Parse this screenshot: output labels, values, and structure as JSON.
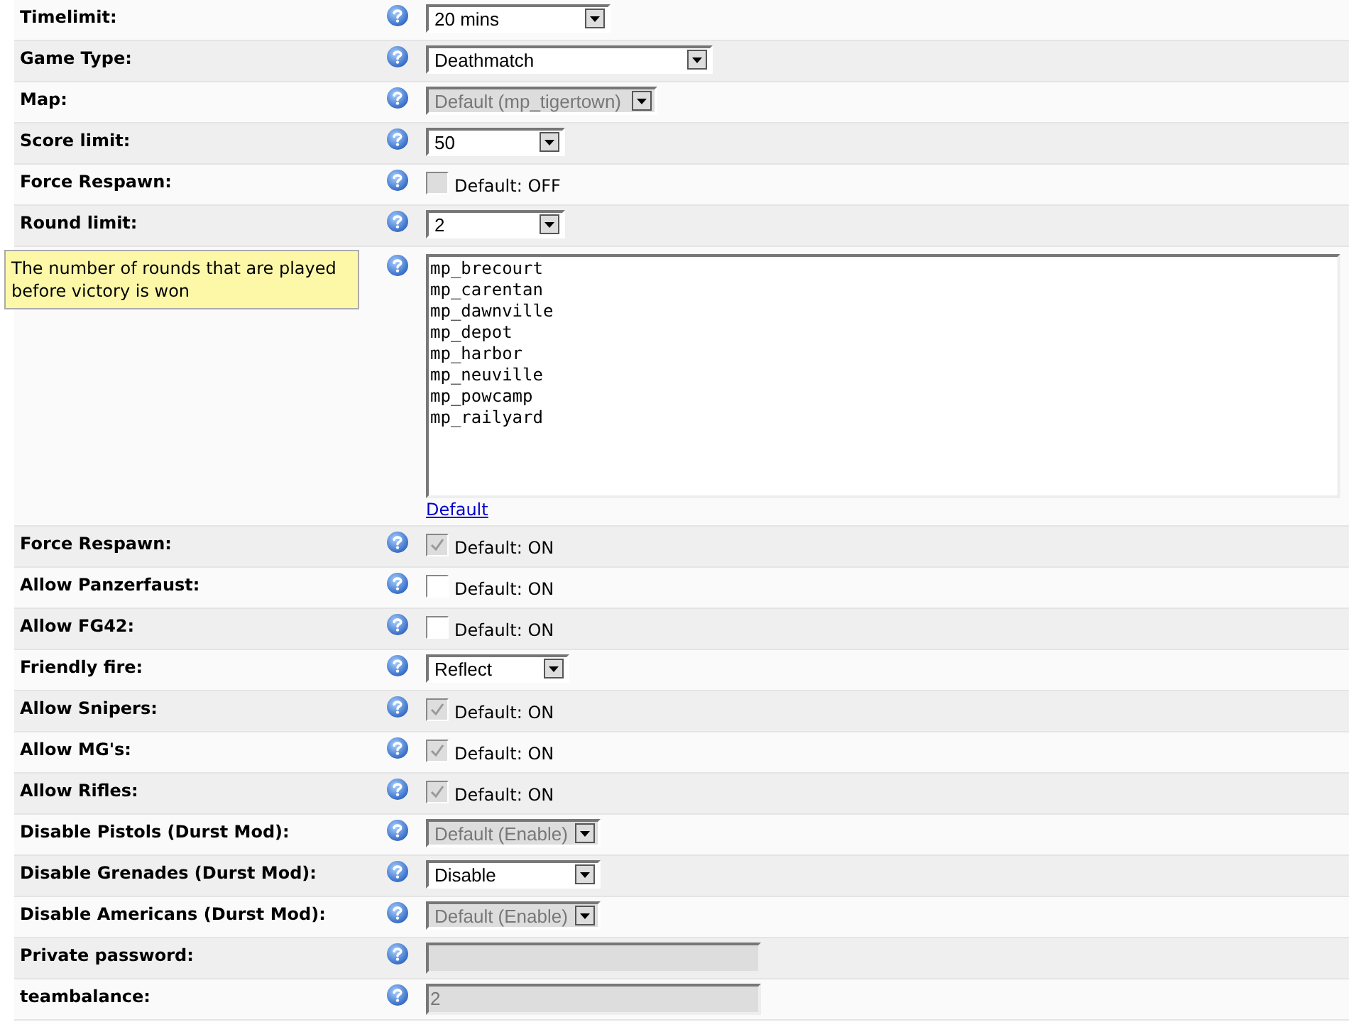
{
  "settings": [
    {
      "kind": "select",
      "label": "Timelimit:",
      "value": "20 mins",
      "disabled": false
    },
    {
      "kind": "select",
      "label": "Game Type:",
      "value": "Deathmatch",
      "disabled": false
    },
    {
      "kind": "select",
      "label": "Map:",
      "value": "Default (mp_tigertown)",
      "disabled": true
    },
    {
      "kind": "select",
      "label": "Score limit:",
      "value": "50",
      "disabled": false
    },
    {
      "kind": "checkbox",
      "label": "Force Respawn:",
      "text": "Default: OFF",
      "checked": false,
      "disabled": true
    },
    {
      "kind": "select",
      "label": "Round limit:",
      "value": "2",
      "disabled": false
    },
    {
      "kind": "maplist",
      "items": [
        "mp_brecourt",
        "mp_carentan",
        "mp_dawnville",
        "mp_depot",
        "mp_harbor",
        "mp_neuville",
        "mp_powcamp",
        "mp_railyard"
      ],
      "link": "Default"
    },
    {
      "kind": "checkbox",
      "label": "Force Respawn:",
      "text": "Default: ON",
      "checked": true,
      "disabled": true
    },
    {
      "kind": "checkbox",
      "label": "Allow Panzerfaust:",
      "text": "Default: ON",
      "checked": false,
      "disabled": false
    },
    {
      "kind": "checkbox",
      "label": "Allow FG42:",
      "text": "Default: ON",
      "checked": false,
      "disabled": false
    },
    {
      "kind": "select",
      "label": "Friendly fire:",
      "value": "Reflect",
      "disabled": false
    },
    {
      "kind": "checkbox",
      "label": "Allow Snipers:",
      "text": "Default: ON",
      "checked": true,
      "disabled": true
    },
    {
      "kind": "checkbox",
      "label": "Allow MG's:",
      "text": "Default: ON",
      "checked": true,
      "disabled": true
    },
    {
      "kind": "checkbox",
      "label": "Allow Rifles:",
      "text": "Default: ON",
      "checked": true,
      "disabled": true
    },
    {
      "kind": "select",
      "label": "Disable Pistols (Durst Mod):",
      "value": "Default (Enable)",
      "disabled": true
    },
    {
      "kind": "select",
      "label": "Disable Grenades (Durst Mod):",
      "value": "Disable",
      "disabled": false
    },
    {
      "kind": "select",
      "label": "Disable Americans (Durst Mod):",
      "value": "Default (Enable)",
      "disabled": true
    },
    {
      "kind": "text",
      "label": "Private password:",
      "disabled": true
    },
    {
      "kind": "text",
      "label": "teambalance:",
      "value": "2",
      "disabled": true
    }
  ],
  "tooltip": "The number of rounds that are played before victory is won"
}
